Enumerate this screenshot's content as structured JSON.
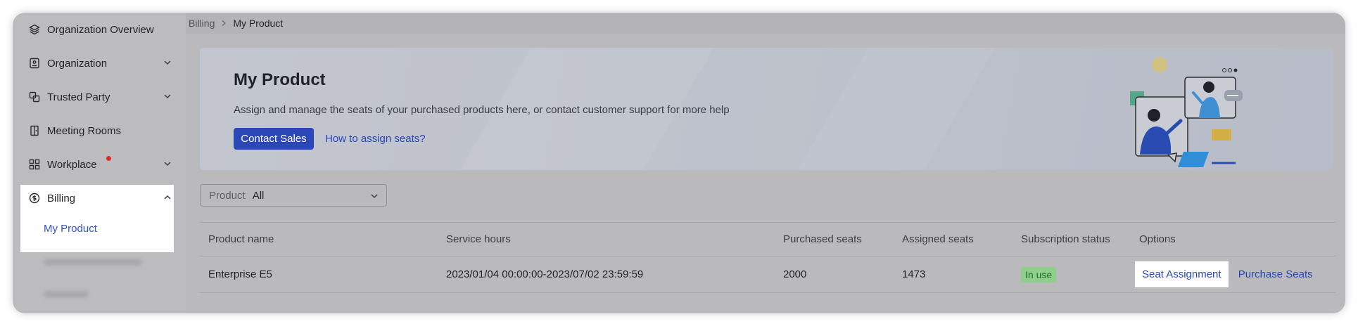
{
  "sidebar": {
    "items": [
      {
        "label": "Organization Overview",
        "icon": "layers-icon",
        "expandable": false
      },
      {
        "label": "Organization",
        "icon": "org-id-icon",
        "expandable": true
      },
      {
        "label": "Trusted Party",
        "icon": "link-squares-icon",
        "expandable": true
      },
      {
        "label": "Meeting Rooms",
        "icon": "door-icon",
        "expandable": false
      },
      {
        "label": "Workplace",
        "icon": "grid-icon",
        "expandable": true,
        "notification_dot": true
      },
      {
        "label": "Billing",
        "icon": "dollar-circle-icon",
        "expandable": true,
        "expanded": true
      }
    ],
    "sub_items": [
      {
        "label": "My Product",
        "active": true
      }
    ]
  },
  "breadcrumb": {
    "parent": "Billing",
    "current": "My Product"
  },
  "banner": {
    "title": "My Product",
    "description": "Assign and manage the seats of your purchased products here, or contact customer support for more help",
    "primary_button": "Contact Sales",
    "help_link": "How to assign seats?"
  },
  "filter": {
    "label": "Product",
    "value": "All"
  },
  "table": {
    "columns": [
      "Product name",
      "Service hours",
      "Purchased seats",
      "Assigned seats",
      "Subscription status",
      "Options"
    ],
    "rows": [
      {
        "product_name": "Enterprise E5",
        "service_hours": "2023/01/04 00:00:00-2023/07/02 23:59:59",
        "purchased_seats": "2000",
        "assigned_seats": "1473",
        "status": "In use",
        "options": [
          "Seat Assignment",
          "Purchase Seats"
        ]
      }
    ]
  },
  "colors": {
    "accent": "#2c48b8",
    "link": "#2845b8",
    "status_green": "#8fcf8c",
    "notification": "#e02e26"
  }
}
